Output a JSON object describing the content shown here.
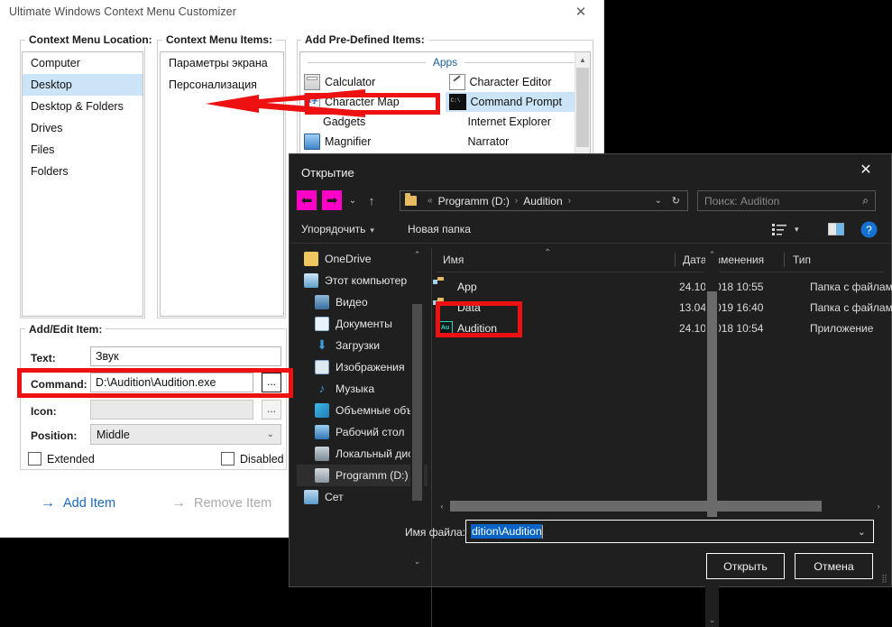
{
  "app": {
    "title": "Ultimate Windows Context Menu Customizer",
    "close_icon": "close-icon",
    "groups": {
      "location_label": "Context Menu Location:",
      "items_label": "Context Menu Items:",
      "predefined_label": "Add Pre-Defined Items:",
      "addedit_label": "Add/Edit Item:"
    },
    "locations": [
      {
        "label": "Computer",
        "selected": false
      },
      {
        "label": "Desktop",
        "selected": true
      },
      {
        "label": "Desktop & Folders",
        "selected": false
      },
      {
        "label": "Drives",
        "selected": false
      },
      {
        "label": "Files",
        "selected": false
      },
      {
        "label": "Folders",
        "selected": false
      }
    ],
    "menu_items": [
      {
        "label": "Параметры экрана"
      },
      {
        "label": "Персонализация"
      }
    ],
    "predefined": {
      "section": "Apps",
      "items": [
        {
          "label": "Calculator",
          "icon": "calculator-icon",
          "selected": false
        },
        {
          "label": "Character Editor",
          "icon": "character-editor-icon",
          "selected": false
        },
        {
          "label": "Character Map",
          "icon": "character-map-icon",
          "selected": false
        },
        {
          "label": "Command Prompt",
          "icon": "command-prompt-icon",
          "selected": true
        },
        {
          "label": "Gadgets",
          "icon": "none",
          "selected": false
        },
        {
          "label": "Internet Explorer",
          "icon": "none",
          "selected": false
        },
        {
          "label": "Magnifier",
          "icon": "magnifier-icon",
          "selected": false
        },
        {
          "label": "Narrator",
          "icon": "none",
          "selected": false
        }
      ]
    },
    "form": {
      "text_label": "Text:",
      "text_value": "Звук",
      "command_label": "Command:",
      "command_value": "D:\\Audition\\Audition.exe",
      "browse_label": "...",
      "icon_label": "Icon:",
      "icon_value": "",
      "icon_browse_label": "...",
      "position_label": "Position:",
      "position_value": "Middle",
      "extended_label": "Extended",
      "disabled_label": "Disabled"
    },
    "actions": {
      "add_label": "Add Item",
      "add_arrow": "→",
      "remove_label": "Remove Item",
      "remove_arrow": "→"
    }
  },
  "dialog": {
    "title": "Открытие",
    "close_icon": "close-icon",
    "nav": {
      "back_icon": "back-arrow-icon",
      "forward_icon": "forward-arrow-icon",
      "recent_icon": "chevron-down-icon",
      "up_icon": "up-arrow-icon",
      "breadcrumb_prefix": "«",
      "breadcrumb": [
        "Programm (D:)",
        "Audition"
      ],
      "breadcrumb_sep": "›",
      "dropdown_icon": "chevron-down-icon",
      "refresh_icon": "refresh-icon"
    },
    "search": {
      "placeholder": "Поиск: Audition",
      "icon": "search-icon"
    },
    "commandbar": {
      "organize_label": "Упорядочить",
      "organize_caret": "▾",
      "newfolder_label": "Новая папка",
      "view_icon": "view-list-icon",
      "view_caret": "▾",
      "pane_icon": "preview-pane-icon",
      "help_icon": "help-icon"
    },
    "tree": [
      {
        "label": "OneDrive",
        "icon": "onedrive-folder-icon",
        "indent": 0,
        "selected": false
      },
      {
        "label": "Этот компьютер",
        "icon": "this-pc-icon",
        "indent": 0,
        "selected": false
      },
      {
        "label": "Видео",
        "icon": "videos-icon",
        "indent": 1,
        "selected": false
      },
      {
        "label": "Документы",
        "icon": "documents-icon",
        "indent": 1,
        "selected": false
      },
      {
        "label": "Загрузки",
        "icon": "downloads-icon",
        "indent": 1,
        "selected": false
      },
      {
        "label": "Изображения",
        "icon": "pictures-icon",
        "indent": 1,
        "selected": false
      },
      {
        "label": "Музыка",
        "icon": "music-icon",
        "indent": 1,
        "selected": false
      },
      {
        "label": "Объемные объ",
        "icon": "3d-objects-icon",
        "indent": 1,
        "selected": false
      },
      {
        "label": "Рабочий стол",
        "icon": "desktop-icon",
        "indent": 1,
        "selected": false
      },
      {
        "label": "Локальный дис",
        "icon": "local-disk-icon",
        "indent": 1,
        "selected": false
      },
      {
        "label": "Programm (D:)",
        "icon": "drive-icon",
        "indent": 1,
        "selected": true
      },
      {
        "label": "Сет",
        "icon": "network-icon",
        "indent": 0,
        "selected": false
      }
    ],
    "columns": {
      "name": "Имя",
      "date": "Дата изменения",
      "type": "Тип",
      "sort_caret": "⌃"
    },
    "files": [
      {
        "name": "App",
        "date": "24.10.2018 10:55",
        "type": "Папка с файлами",
        "icon": "folder-icon"
      },
      {
        "name": "Data",
        "date": "13.04.2019 16:40",
        "type": "Папка с файлами",
        "icon": "folder-icon"
      },
      {
        "name": "Audition",
        "date": "24.10.2018 10:54",
        "type": "Приложение",
        "icon": "audition-app-icon"
      }
    ],
    "footer": {
      "filename_label": "Имя файла:",
      "filename_value": "dition\\Audition",
      "filename_dropdown_icon": "chevron-down-icon",
      "open_label": "Открыть",
      "cancel_label": "Отмена"
    }
  },
  "annotations": {
    "color": "#ee1111",
    "marks": [
      {
        "name": "character-map-highlight",
        "shape": "rect"
      },
      {
        "name": "pointer-arrow",
        "shape": "arrow"
      },
      {
        "name": "command-field-highlight",
        "shape": "rect"
      },
      {
        "name": "audition-file-highlight",
        "shape": "rect"
      }
    ]
  }
}
